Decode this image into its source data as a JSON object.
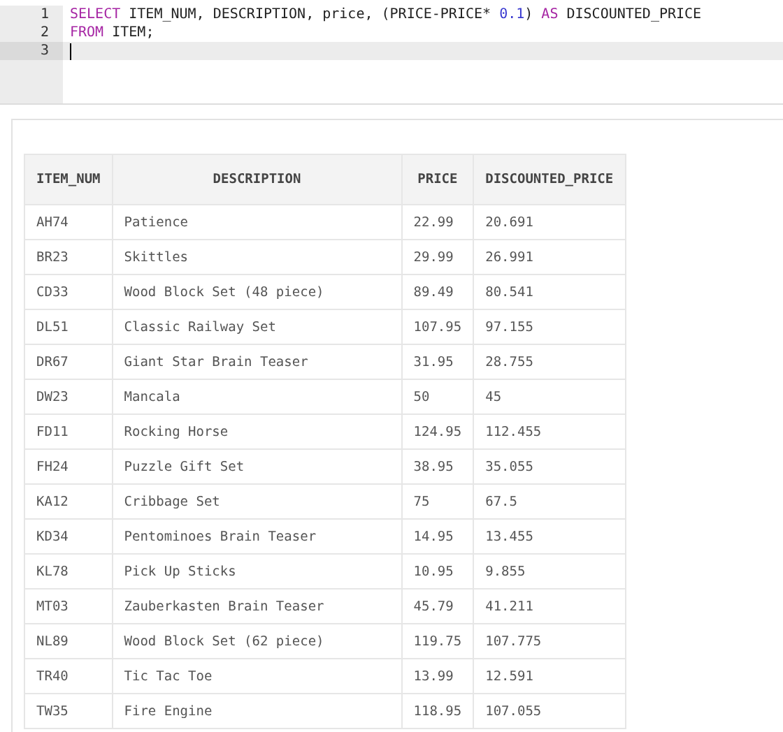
{
  "editor": {
    "lines": [
      {
        "number": "1",
        "current": false,
        "tokens": [
          {
            "kind": "keyword",
            "text": "SELECT"
          },
          {
            "kind": "plain",
            "text": " ITEM_NUM, DESCRIPTION, price, (PRICE-PRICE* "
          },
          {
            "kind": "number",
            "text": "0.1"
          },
          {
            "kind": "plain",
            "text": ") "
          },
          {
            "kind": "keyword",
            "text": "AS"
          },
          {
            "kind": "plain",
            "text": " DISCOUNTED_PRICE"
          }
        ]
      },
      {
        "number": "2",
        "current": false,
        "tokens": [
          {
            "kind": "keyword",
            "text": "FROM"
          },
          {
            "kind": "plain",
            "text": " ITEM;"
          }
        ]
      },
      {
        "number": "3",
        "current": true
      }
    ]
  },
  "results": {
    "columns": [
      "ITEM_NUM",
      "DESCRIPTION",
      "PRICE",
      "DISCOUNTED_PRICE"
    ],
    "rows": [
      [
        "AH74",
        "Patience",
        "22.99",
        "20.691"
      ],
      [
        "BR23",
        "Skittles",
        "29.99",
        "26.991"
      ],
      [
        "CD33",
        "Wood Block Set (48 piece)",
        "89.49",
        "80.541"
      ],
      [
        "DL51",
        "Classic Railway Set",
        "107.95",
        "97.155"
      ],
      [
        "DR67",
        "Giant Star Brain Teaser",
        "31.95",
        "28.755"
      ],
      [
        "DW23",
        "Mancala",
        "50",
        "45"
      ],
      [
        "FD11",
        "Rocking Horse",
        "124.95",
        "112.455"
      ],
      [
        "FH24",
        "Puzzle Gift Set",
        "38.95",
        "35.055"
      ],
      [
        "KA12",
        "Cribbage Set",
        "75",
        "67.5"
      ],
      [
        "KD34",
        "Pentominoes Brain Teaser",
        "14.95",
        "13.455"
      ],
      [
        "KL78",
        "Pick Up Sticks",
        "10.95",
        "9.855"
      ],
      [
        "MT03",
        "Zauberkasten Brain Teaser",
        "45.79",
        "41.211"
      ],
      [
        "NL89",
        "Wood Block Set (62 piece)",
        "119.75",
        "107.775"
      ],
      [
        "TR40",
        "Tic Tac Toe",
        "13.99",
        "12.591"
      ],
      [
        "TW35",
        "Fire Engine",
        "118.95",
        "107.055"
      ]
    ]
  }
}
